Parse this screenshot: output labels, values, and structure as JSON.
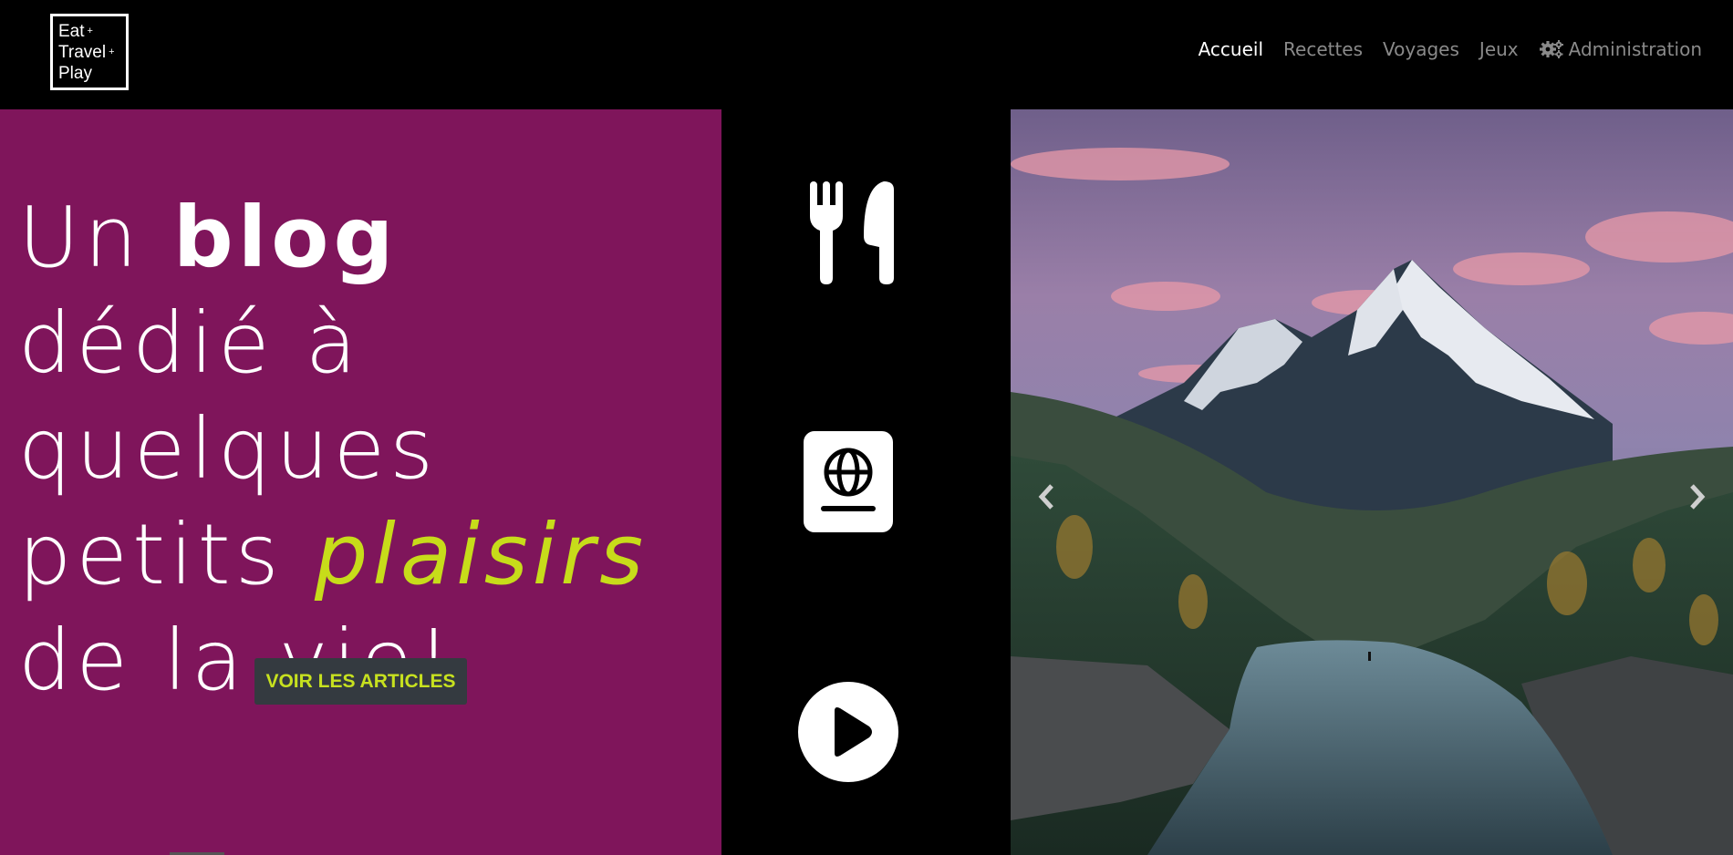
{
  "logo": {
    "line1": "Eat",
    "line2": "Travel",
    "line3": "Play"
  },
  "nav": {
    "items": [
      {
        "label": "Accueil",
        "active": true
      },
      {
        "label": "Recettes"
      },
      {
        "label": "Voyages"
      },
      {
        "label": "Jeux"
      },
      {
        "label": "Administration",
        "icon": "cogs-icon"
      }
    ]
  },
  "hero": {
    "line1_a": "Un",
    "line1_b": "blog",
    "line2": "dédié à",
    "line3": "quelques",
    "line4_a": "petits",
    "line4_b": "plaisirs",
    "line5": "de la vie!",
    "cta_label": "VOIR LES ARTICLES"
  },
  "icons": [
    "utensils-icon",
    "passport-icon",
    "play-circle-icon"
  ],
  "carousel": {
    "prev_icon": "chevron-left-icon",
    "next_icon": "chevron-right-icon"
  },
  "colors": {
    "hero_bg": "#7f155b",
    "accent": "#c7dc1a",
    "cta_bg": "#343a40",
    "cta_text": "#c7e11f",
    "nav_active": "#ffffff",
    "nav_inactive": "#8a8a8a"
  }
}
